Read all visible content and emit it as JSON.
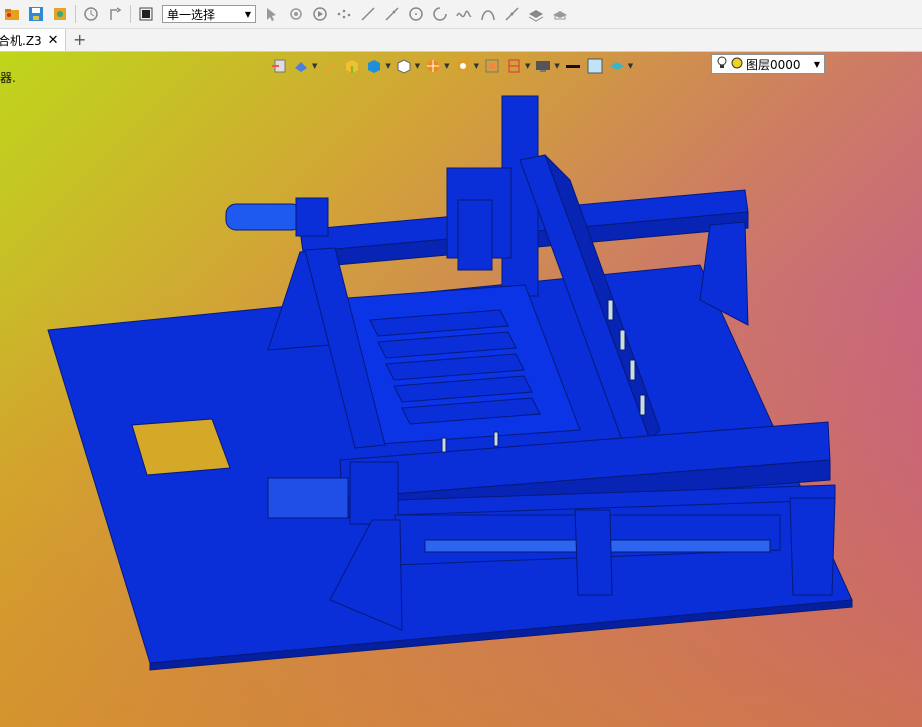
{
  "toolbar": {
    "selection_mode": "单一选择"
  },
  "tabs": [
    {
      "label": "合机.Z3",
      "close": "✕"
    }
  ],
  "tab_add": "+",
  "status_text": "器.",
  "layer": {
    "label": "图层0000"
  },
  "colors": {
    "model_blue": "#0a2ed8",
    "model_edge": "#061a7a",
    "gradient_left": "#bfd61a",
    "gradient_right": "#c246a6"
  },
  "icons": [
    "folder-icon",
    "save-icon",
    "settings-icon",
    "rotate-icon",
    "redo-icon",
    "select-box-icon",
    "pointer-icon",
    "target-icon",
    "play-icon",
    "points-icon",
    "line-icon",
    "pen-icon",
    "circle-icon",
    "arc-icon",
    "curve-icon",
    "bezier-icon",
    "spline-icon",
    "layers-icon",
    "hat-icon"
  ]
}
